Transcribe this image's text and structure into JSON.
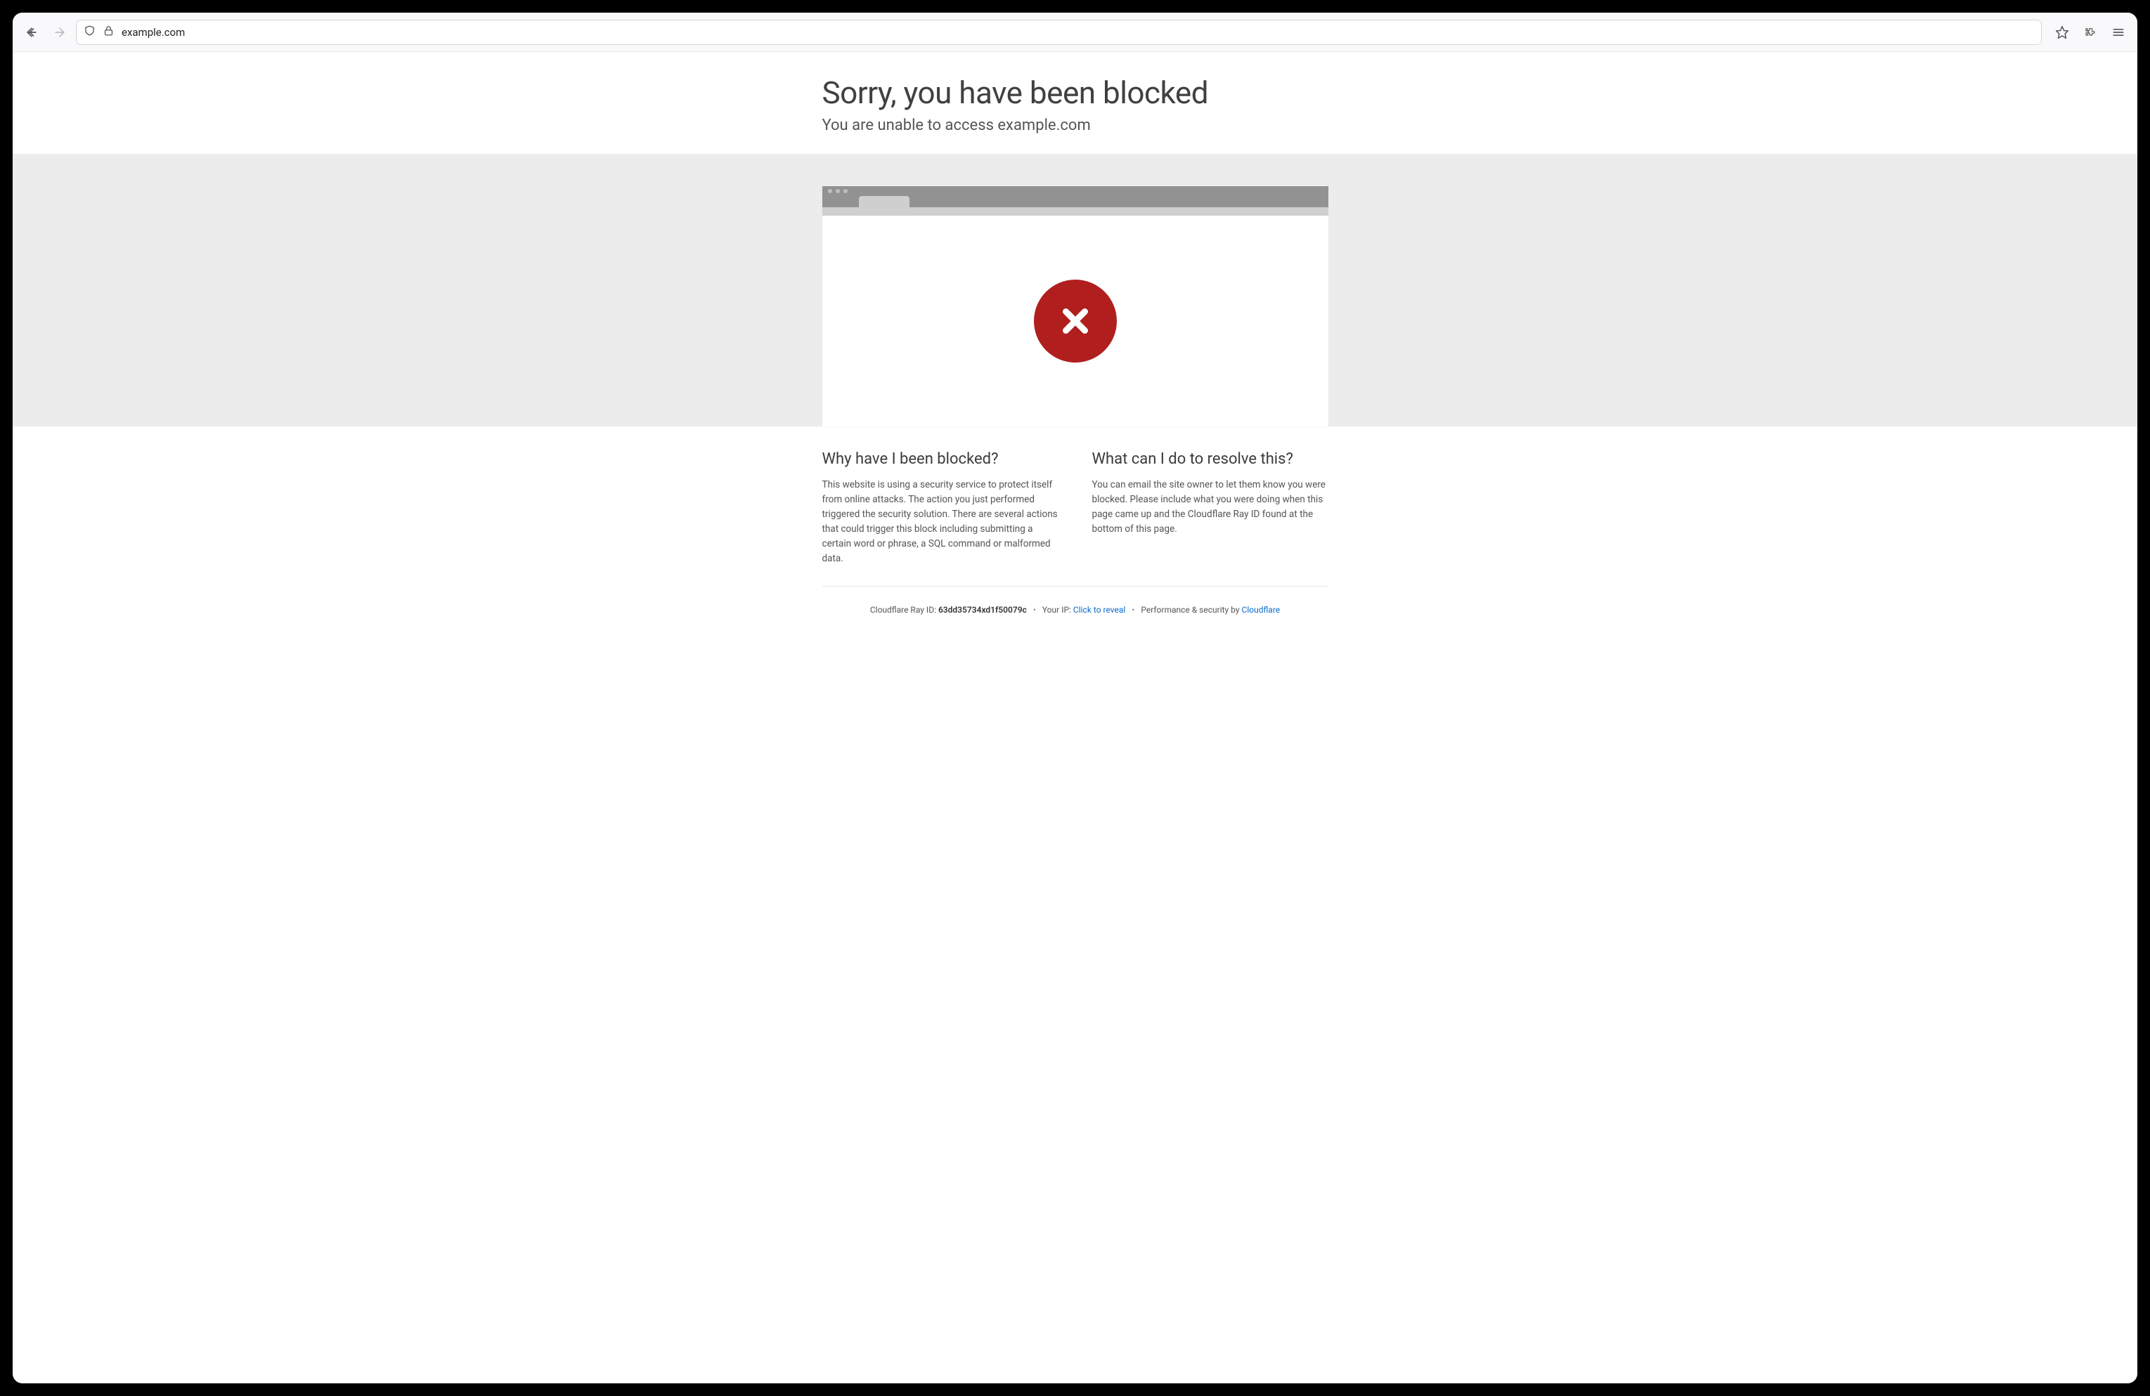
{
  "browser": {
    "url": "example.com"
  },
  "header": {
    "title": "Sorry, you have been blocked",
    "subtitle_prefix": "You are unable to access ",
    "subtitle_domain": "example.com"
  },
  "columns": {
    "left": {
      "heading": "Why have I been blocked?",
      "body": "This website is using a security service to protect itself from online attacks. The action you just performed triggered the security solution. There are several actions that could trigger this block including submitting a certain word or phrase, a SQL command or malformed data."
    },
    "right": {
      "heading": "What can I do to resolve this?",
      "body": "You can email the site owner to let them know you were blocked. Please include what you were doing when this page came up and the Cloudflare Ray ID found at the bottom of this page."
    }
  },
  "footer": {
    "ray_label": "Cloudflare Ray ID: ",
    "ray_id": "63dd35734xd1f50079c",
    "ip_label": "Your IP: ",
    "ip_reveal": "Click to reveal",
    "perf_label": "Performance & security by ",
    "perf_link": "Cloudflare",
    "sep": "•"
  }
}
